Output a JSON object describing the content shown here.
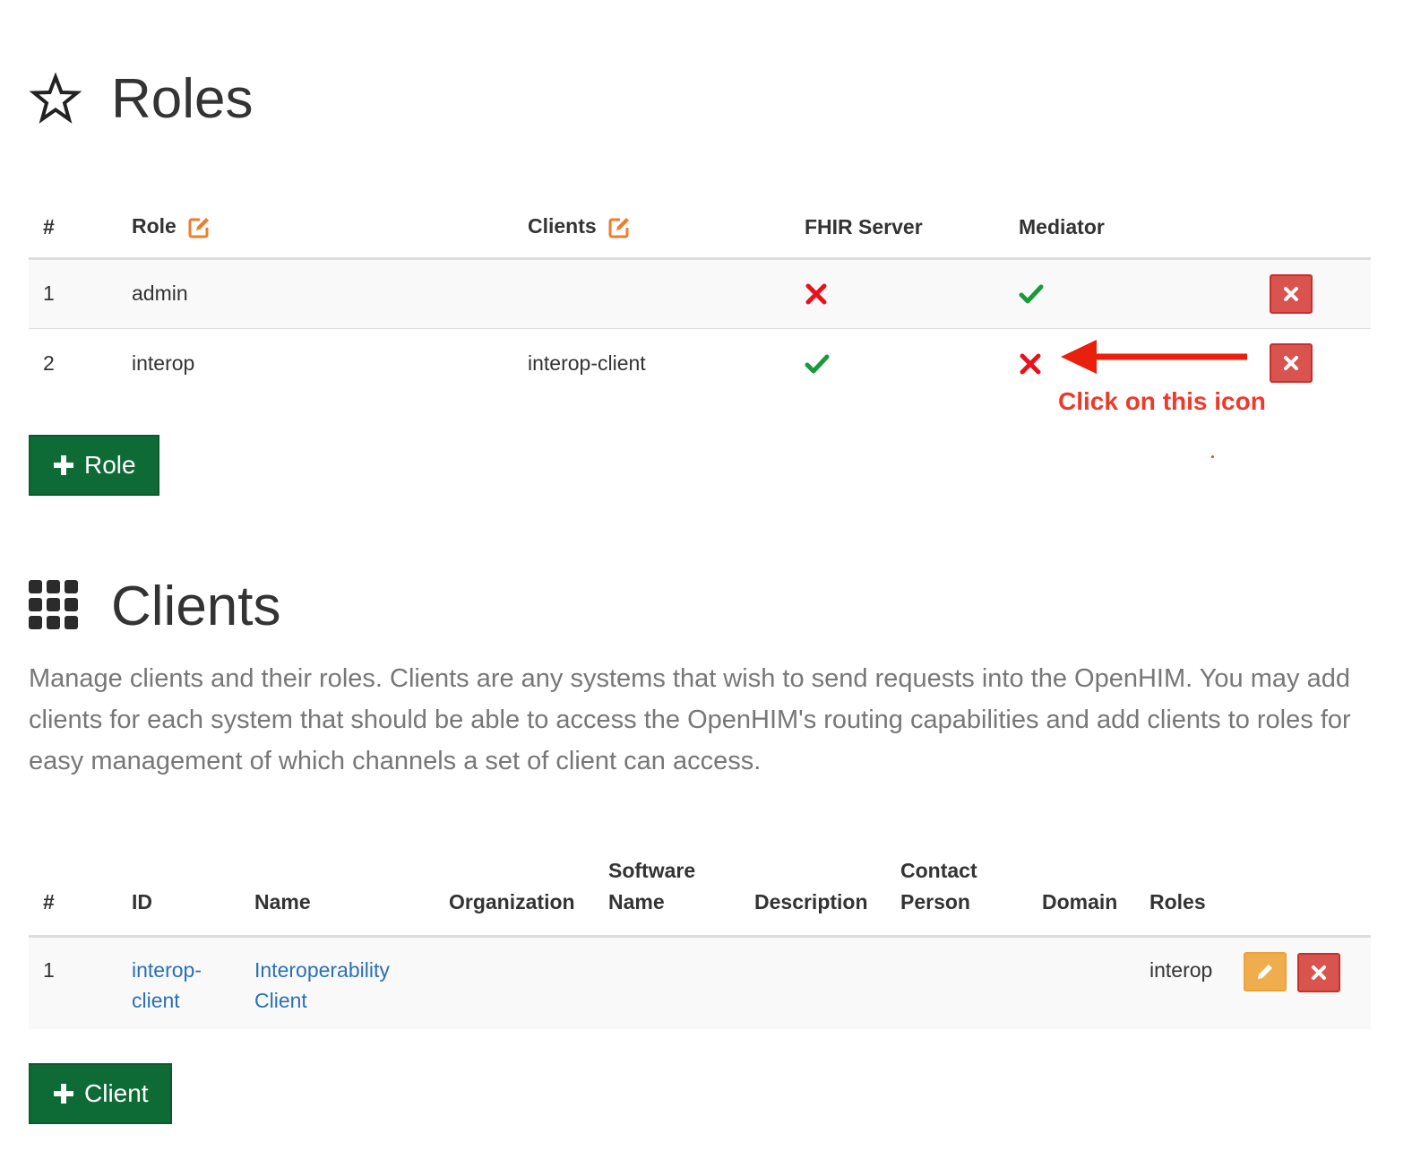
{
  "roles": {
    "title": "Roles",
    "columns": {
      "num": "#",
      "role": "Role",
      "clients": "Clients",
      "fhir": "FHIR Server",
      "mediator": "Mediator"
    },
    "rows": [
      {
        "num": "1",
        "role": "admin",
        "clients": "",
        "fhir": false,
        "mediator": true
      },
      {
        "num": "2",
        "role": "interop",
        "clients": "interop-client",
        "fhir": true,
        "mediator": false
      }
    ],
    "add_button_label": "Role",
    "annotation": "Click on this icon"
  },
  "clients": {
    "title": "Clients",
    "description": "Manage clients and their roles. Clients are any systems that wish to send requests into the OpenHIM. You may add clients for each system that should be able to access the OpenHIM's routing capabilities and add clients to roles for easy management of which channels a set of client can access.",
    "columns": {
      "num": "#",
      "id": "ID",
      "name": "Name",
      "organization": "Organization",
      "software_name_1": "Software",
      "software_name_2": "Name",
      "description": "Description",
      "contact_1": "Contact",
      "contact_2": "Person",
      "domain": "Domain",
      "roles": "Roles"
    },
    "rows": [
      {
        "num": "1",
        "id_1": "interop-",
        "id_2": "client",
        "name_1": "Interoperability",
        "name_2": "Client",
        "organization": "",
        "software_name": "",
        "description": "",
        "contact": "",
        "domain": "",
        "roles": "interop"
      }
    ],
    "add_button_label": "Client"
  },
  "colors": {
    "success": "#0e6b36",
    "danger": "#d9534f",
    "warning": "#f0ad4e",
    "link": "#2a70b8",
    "check": "#1a9a3a",
    "cross": "#e8121a",
    "annotation": "#f0392b",
    "edit_icon": "#f07c2c"
  },
  "icons": {
    "roles_heading": "star-outline-icon",
    "clients_heading": "grid-icon",
    "edit": "edit-square-icon",
    "yes": "check-icon",
    "no": "cross-icon",
    "delete": "times-icon",
    "pencil": "pencil-icon",
    "add": "plus-icon"
  }
}
